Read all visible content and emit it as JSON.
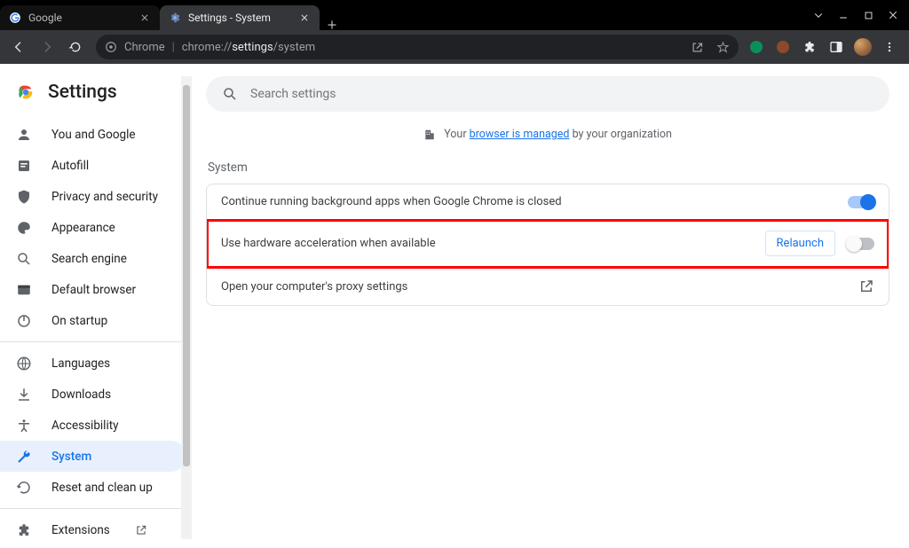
{
  "window": {
    "tabs": [
      {
        "label": "Google",
        "active": false
      },
      {
        "label": "Settings - System",
        "active": true
      }
    ]
  },
  "toolbar": {
    "chrome_label": "Chrome",
    "url_prefix": "chrome://",
    "url_bold": "settings",
    "url_suffix": "/system"
  },
  "sidebar": {
    "title": "Settings",
    "items": [
      {
        "id": "you",
        "label": "You and Google"
      },
      {
        "id": "autofill",
        "label": "Autofill"
      },
      {
        "id": "privacy",
        "label": "Privacy and security"
      },
      {
        "id": "appearance",
        "label": "Appearance"
      },
      {
        "id": "search",
        "label": "Search engine"
      },
      {
        "id": "default",
        "label": "Default browser"
      },
      {
        "id": "startup",
        "label": "On startup"
      }
    ],
    "items2": [
      {
        "id": "languages",
        "label": "Languages"
      },
      {
        "id": "downloads",
        "label": "Downloads"
      },
      {
        "id": "accessibility",
        "label": "Accessibility"
      },
      {
        "id": "system",
        "label": "System",
        "selected": true
      },
      {
        "id": "reset",
        "label": "Reset and clean up"
      }
    ],
    "items3": [
      {
        "id": "extensions",
        "label": "Extensions"
      }
    ]
  },
  "main": {
    "search_placeholder": "Search settings",
    "managed_prefix": "Your ",
    "managed_link": "browser is managed",
    "managed_suffix": " by your organization",
    "section_title": "System",
    "rows": {
      "bg_apps": "Continue running background apps when Google Chrome is closed",
      "hw_accel": "Use hardware acceleration when available",
      "relaunch": "Relaunch",
      "proxy": "Open your computer's proxy settings"
    }
  }
}
